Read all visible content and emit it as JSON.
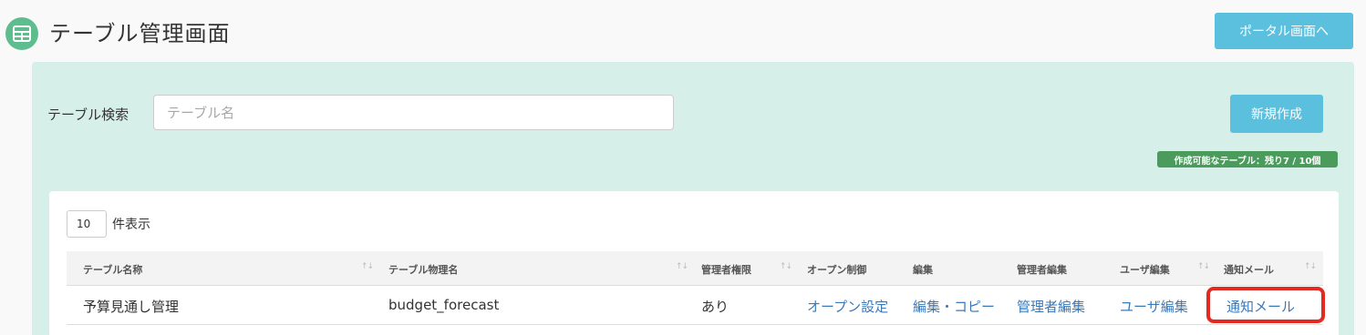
{
  "header": {
    "title": "テーブル管理画面",
    "logo_icon": "table-icon",
    "portal_button": "ポータル画面へ"
  },
  "search": {
    "label": "テーブル検索",
    "placeholder": "テーブル名",
    "value": ""
  },
  "actions": {
    "new_button": "新規作成",
    "quota_badge": "作成可能なテーブル：残り7 / 10個"
  },
  "table": {
    "length_value": "10",
    "length_label": "件表示",
    "headers": {
      "name": "テーブル名称",
      "physical": "テーブル物理名",
      "admin_perm": "管理者権限",
      "open_ctrl": "オープン制御",
      "edit": "編集",
      "admin_edit": "管理者編集",
      "user_edit": "ユーザ編集",
      "notify": "通知メール"
    },
    "rows": [
      {
        "name": "予算見通し管理",
        "physical": "budget_forecast",
        "admin_perm": "あり",
        "open_ctrl": "オープン設定",
        "edit": "編集・コピー",
        "admin_edit": "管理者編集",
        "user_edit": "ユーザ編集",
        "notify": "通知メール"
      }
    ]
  },
  "colors": {
    "accent": "#5bc0de",
    "panel": "#d6efe8",
    "badge": "#4a9b5c",
    "link": "#3a78b8",
    "highlight": "#e32a22"
  }
}
